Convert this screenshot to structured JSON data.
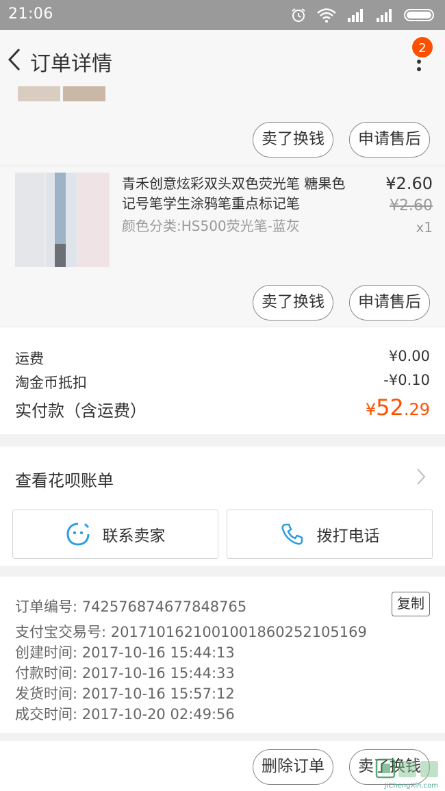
{
  "status_bar": {
    "time": "21:06"
  },
  "navbar": {
    "title": "订单详情",
    "badge_count": "2"
  },
  "product_block_1": {
    "buttons": {
      "resell": "卖了换钱",
      "after_sale": "申请售后"
    }
  },
  "product_block_2": {
    "title": "青禾创意炫彩双头双色荧光笔 糖果色记号笔学生涂鸦笔重点标记笔",
    "sku": "颜色分类:HS500荧光笔-蓝灰",
    "price": "¥2.60",
    "original_price": "¥2.60",
    "quantity": "x1",
    "buttons": {
      "resell": "卖了换钱",
      "after_sale": "申请售后"
    }
  },
  "summary": {
    "shipping_label": "运费",
    "shipping_value": "¥0.00",
    "coin_label": "淘金币抵扣",
    "coin_value": "-¥0.10",
    "paid_label": "实付款（含运费）",
    "paid_currency": "¥",
    "paid_integer": "52",
    "paid_decimal": ".29"
  },
  "huabei": {
    "label": "查看花呗账单"
  },
  "contact": {
    "seller_label": "联系卖家",
    "phone_label": "拨打电话"
  },
  "order_info": {
    "order_no": "订单编号: 742576874677848765",
    "copy_label": "复制",
    "alipay_no": "支付宝交易号: 2017101621001001860252105169",
    "created": "创建时间: 2017-10-16 15:44:13",
    "paid": "付款时间: 2017-10-16 15:44:33",
    "shipped": "发货时间: 2017-10-16 15:57:12",
    "closed": "成交时间: 2017-10-20 02:49:56"
  },
  "bottom_bar": {
    "delete_label": "删除订单",
    "resell_label": "卖了换钱"
  },
  "watermark": {
    "text": "JiChengXin.com"
  },
  "colors": {
    "accent": "#ff5000",
    "contact_icon": "#2b9de0"
  }
}
